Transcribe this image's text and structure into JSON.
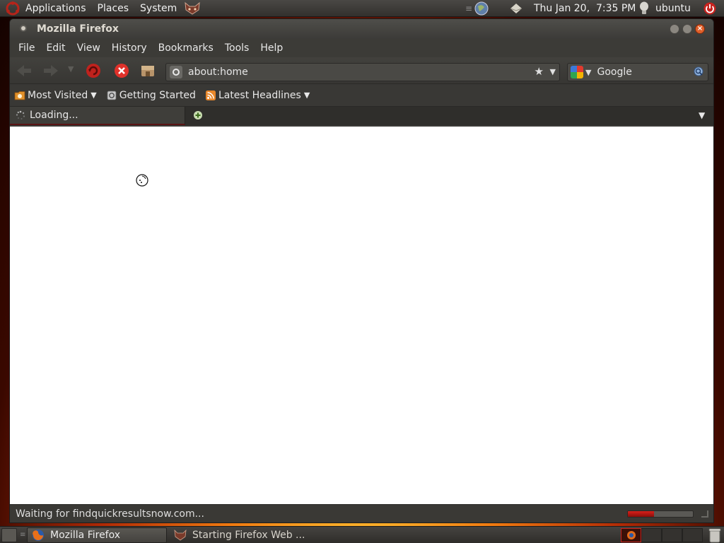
{
  "top_panel": {
    "applications": "Applications",
    "places": "Places",
    "system": "System",
    "datetime": "Thu Jan 20,  7:35 PM",
    "user": "ubuntu"
  },
  "window": {
    "title": "Mozilla Firefox"
  },
  "menubar": {
    "items": [
      "File",
      "Edit",
      "View",
      "History",
      "Bookmarks",
      "Tools",
      "Help"
    ]
  },
  "navbar": {
    "url": "about:home",
    "search_engine": "Google"
  },
  "bookmarks": {
    "items": [
      {
        "label": "Most Visited",
        "icon": "folder-icon",
        "dropdown": true
      },
      {
        "label": "Getting Started",
        "icon": "page-icon",
        "dropdown": false
      },
      {
        "label": "Latest Headlines",
        "icon": "rss-icon",
        "dropdown": true
      }
    ]
  },
  "tabs": {
    "items": [
      {
        "label": "Loading..."
      }
    ]
  },
  "status": {
    "text": "Waiting for findquickresultsnow.com...",
    "progress": 0.4
  },
  "taskbar": {
    "items": [
      {
        "label": "Mozilla Firefox"
      },
      {
        "label": "Starting Firefox Web ..."
      }
    ]
  },
  "colors": {
    "panel": "#3a3835",
    "accent_red": "#c8231f",
    "progress": "#b81414"
  }
}
